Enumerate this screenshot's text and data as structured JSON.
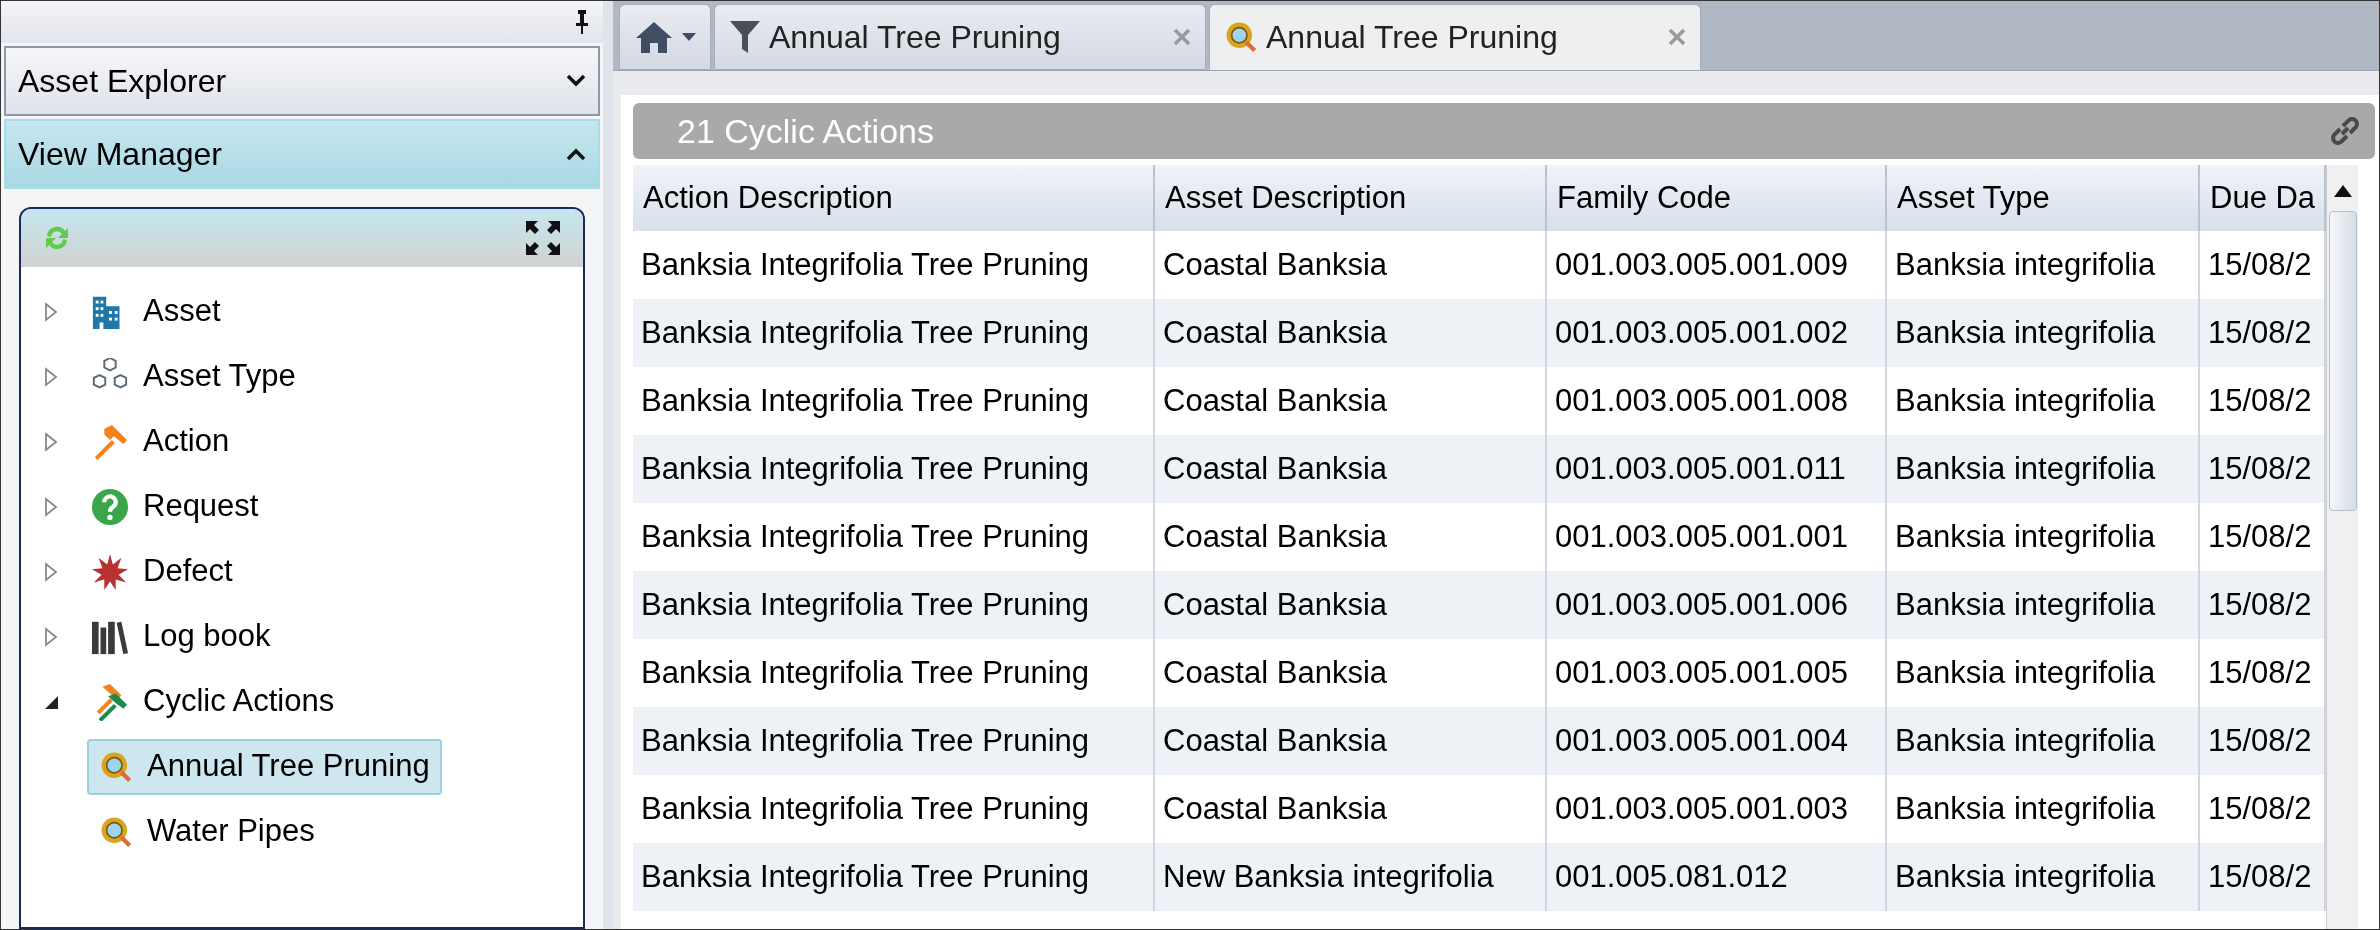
{
  "sidebar": {
    "sections": [
      {
        "title": "Asset Explorer",
        "expanded": false
      },
      {
        "title": "View Manager",
        "expanded": true
      }
    ],
    "tree": [
      {
        "label": "Asset",
        "kind": "building",
        "expanded": false,
        "selected": false
      },
      {
        "label": "Asset Type",
        "kind": "cubes",
        "expanded": false,
        "selected": false
      },
      {
        "label": "Action",
        "kind": "hammer",
        "expanded": false,
        "selected": false
      },
      {
        "label": "Request",
        "kind": "question",
        "expanded": false,
        "selected": false
      },
      {
        "label": "Defect",
        "kind": "burst",
        "expanded": false,
        "selected": false
      },
      {
        "label": "Log book",
        "kind": "books",
        "expanded": false,
        "selected": false
      },
      {
        "label": "Cyclic Actions",
        "kind": "hammers",
        "expanded": true,
        "selected": false,
        "children": [
          {
            "label": "Annual Tree Pruning",
            "kind": "query",
            "selected": true
          },
          {
            "label": "Water Pipes",
            "kind": "query",
            "selected": false
          }
        ]
      }
    ]
  },
  "tabs": [
    {
      "kind": "home",
      "selected": false
    },
    {
      "kind": "filter",
      "label": "Annual Tree Pruning",
      "selected": false
    },
    {
      "kind": "query",
      "label": "Annual Tree Pruning",
      "selected": true
    }
  ],
  "grid": {
    "title": "21 Cyclic Actions",
    "columns": [
      "Action Description",
      "Asset Description",
      "Family Code",
      "Asset Type",
      "Due Da"
    ],
    "rows": [
      [
        "Banksia Integrifolia Tree Pruning",
        "Coastal Banksia",
        "001.003.005.001.009",
        "Banksia integrifolia",
        "15/08/2"
      ],
      [
        "Banksia Integrifolia Tree Pruning",
        "Coastal Banksia",
        "001.003.005.001.002",
        "Banksia integrifolia",
        "15/08/2"
      ],
      [
        "Banksia Integrifolia Tree Pruning",
        "Coastal Banksia",
        "001.003.005.001.008",
        "Banksia integrifolia",
        "15/08/2"
      ],
      [
        "Banksia Integrifolia Tree Pruning",
        "Coastal Banksia",
        "001.003.005.001.011",
        "Banksia integrifolia",
        "15/08/2"
      ],
      [
        "Banksia Integrifolia Tree Pruning",
        "Coastal Banksia",
        "001.003.005.001.001",
        "Banksia integrifolia",
        "15/08/2"
      ],
      [
        "Banksia Integrifolia Tree Pruning",
        "Coastal Banksia",
        "001.003.005.001.006",
        "Banksia integrifolia",
        "15/08/2"
      ],
      [
        "Banksia Integrifolia Tree Pruning",
        "Coastal Banksia",
        "001.003.005.001.005",
        "Banksia integrifolia",
        "15/08/2"
      ],
      [
        "Banksia Integrifolia Tree Pruning",
        "Coastal Banksia",
        "001.003.005.001.004",
        "Banksia integrifolia",
        "15/08/2"
      ],
      [
        "Banksia Integrifolia Tree Pruning",
        "Coastal Banksia",
        "001.003.005.001.003",
        "Banksia integrifolia",
        "15/08/2"
      ],
      [
        "Banksia Integrifolia Tree Pruning",
        "New Banksia integrifolia",
        "001.005.081.012",
        "Banksia integrifolia",
        "15/08/2"
      ]
    ]
  }
}
